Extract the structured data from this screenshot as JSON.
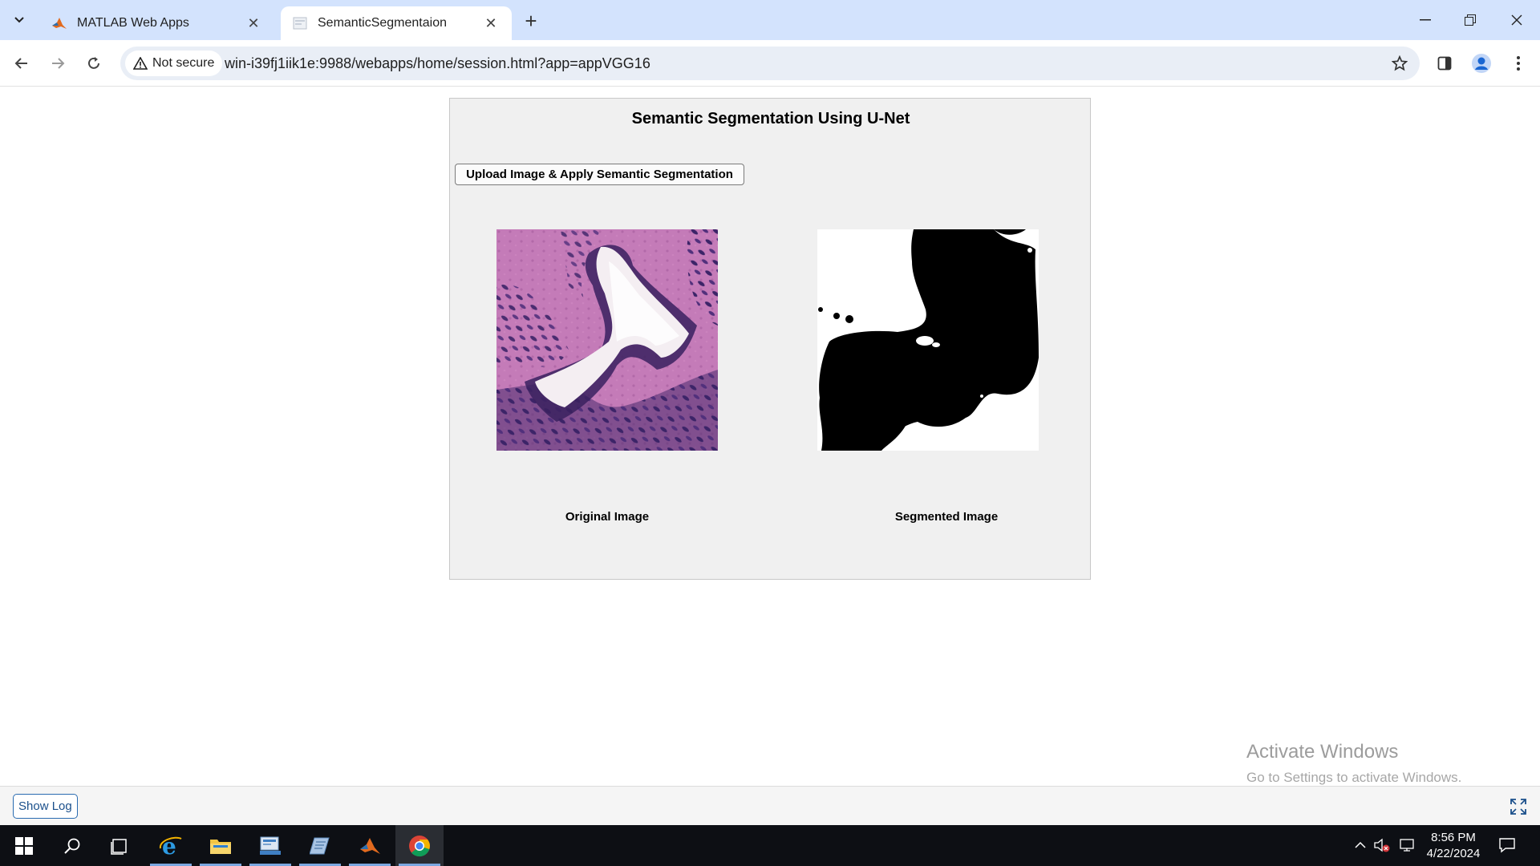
{
  "browser": {
    "tabs": [
      {
        "title": "MATLAB Web Apps",
        "favicon": "matlab-icon",
        "active": false
      },
      {
        "title": "SemanticSegmentaion",
        "favicon": "page-icon",
        "active": true
      }
    ],
    "security_label": "Not secure",
    "url": "win-i39fj1iik1e:9988/webapps/home/session.html?app=appVGG16"
  },
  "app": {
    "title": "Semantic Segmentation Using U-Net",
    "upload_button": "Upload Image & Apply Semantic Segmentation",
    "original_label": "Original Image",
    "segmented_label": "Segmented Image"
  },
  "footer": {
    "show_log": "Show Log",
    "watermark_title": "Activate Windows",
    "watermark_sub": "Go to Settings to activate Windows."
  },
  "taskbar": {
    "time": "8:56 PM",
    "date": "4/22/2024"
  },
  "colors": {
    "tab_strip": "#d3e3fd",
    "panel": "#f0f0f0",
    "taskbar": "#0d0f14",
    "tissue_pink": "#c47bb8",
    "tissue_purple": "#4b2b6e"
  }
}
